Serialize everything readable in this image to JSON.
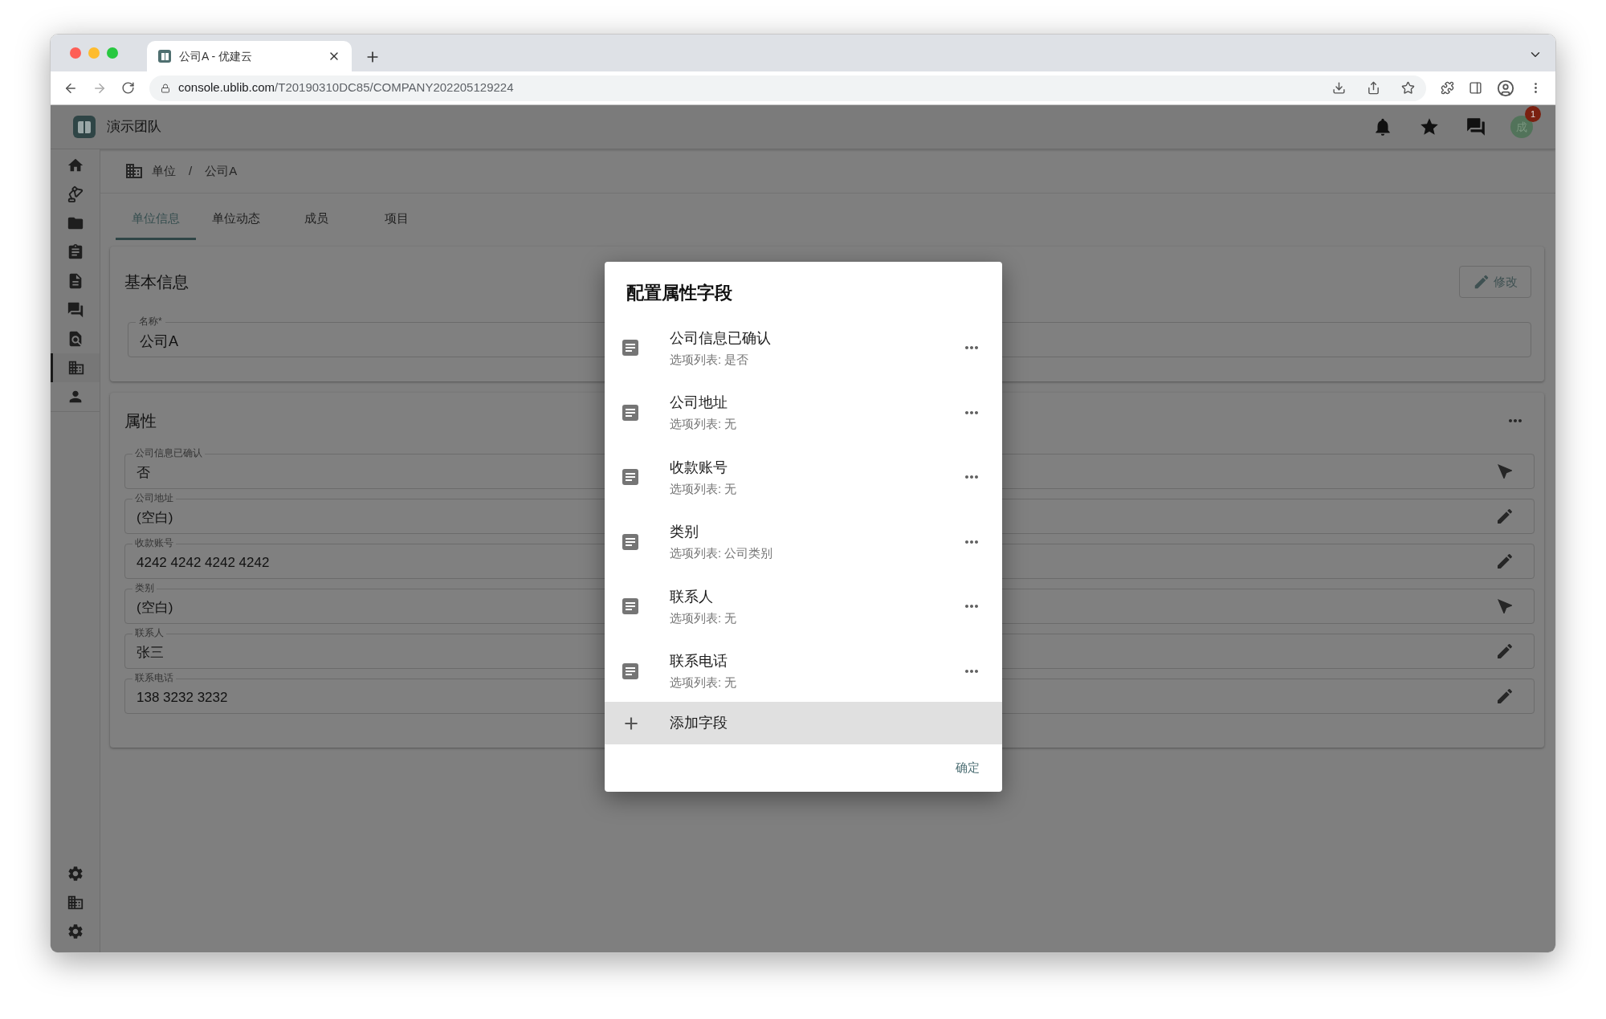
{
  "browser": {
    "tab_title": "公司A - 优建云",
    "url_host": "console.ublib.com",
    "url_path": "/T20190310DC85/COMPANY202205129224"
  },
  "header": {
    "team": "演示团队",
    "notification_count": "1",
    "avatar": "成"
  },
  "sidebar": {
    "items": [
      {
        "selected": false
      },
      {
        "selected": false
      },
      {
        "selected": false
      },
      {
        "selected": false
      },
      {
        "selected": false
      },
      {
        "selected": false
      },
      {
        "selected": false
      },
      {
        "selected": true
      },
      {
        "selected": false
      }
    ],
    "bottom_items": [
      {
        "selected": false
      },
      {
        "selected": false
      },
      {
        "selected": false
      }
    ]
  },
  "breadcrumb": {
    "items": [
      "单位",
      "公司A"
    ],
    "separator": "/"
  },
  "tabs": [
    {
      "label": "单位信息",
      "selected": true
    },
    {
      "label": "单位动态",
      "selected": false
    },
    {
      "label": "成员",
      "selected": false
    },
    {
      "label": "项目",
      "selected": false
    }
  ],
  "basic_info": {
    "title": "基本信息",
    "edit_button": "修改",
    "name_field": {
      "label": "名称*",
      "value": "公司A"
    }
  },
  "properties": {
    "title": "属性",
    "fields": [
      {
        "label": "公司信息已确认",
        "value": "否",
        "kind": "select"
      },
      {
        "label": "公司地址",
        "value": "(空白)",
        "kind": "text"
      },
      {
        "label": "收款账号",
        "value": "4242 4242 4242 4242",
        "kind": "text"
      },
      {
        "label": "类别",
        "value": "(空白)",
        "kind": "select"
      },
      {
        "label": "联系人",
        "value": "张三",
        "kind": "text"
      },
      {
        "label": "联系电话",
        "value": "138 3232 3232",
        "kind": "text"
      }
    ]
  },
  "dialog": {
    "title": "配置属性字段",
    "fields": [
      {
        "name": "公司信息已确认",
        "options": "选项列表: 是否"
      },
      {
        "name": "公司地址",
        "options": "选项列表: 无"
      },
      {
        "name": "收款账号",
        "options": "选项列表: 无"
      },
      {
        "name": "类别",
        "options": "选项列表: 公司类别"
      },
      {
        "name": "联系人",
        "options": "选项列表: 无"
      },
      {
        "name": "联系电话",
        "options": "选项列表: 无"
      }
    ],
    "add_button": "添加字段",
    "confirm_button": "确定"
  }
}
